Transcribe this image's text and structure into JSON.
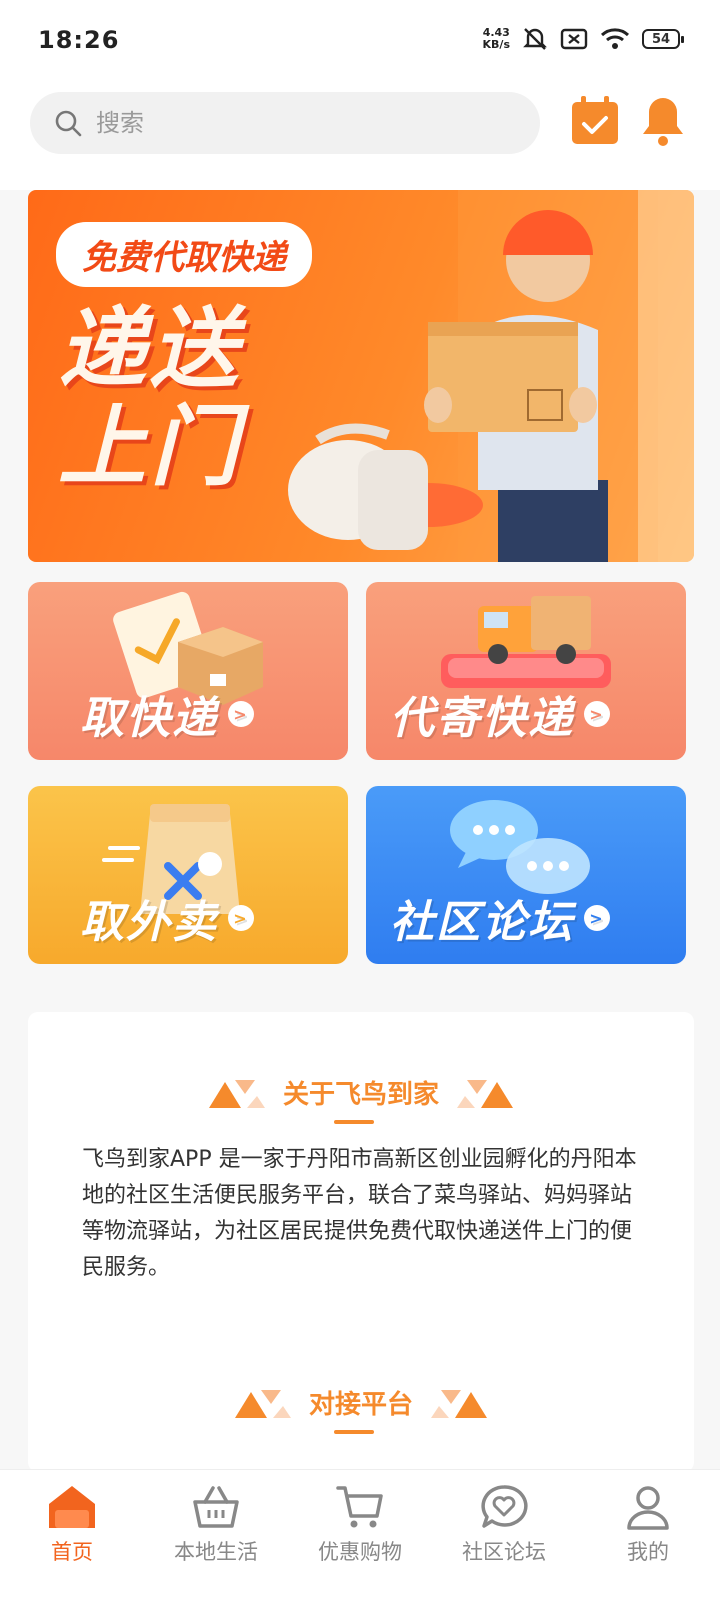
{
  "status_bar": {
    "time": "18:26",
    "net_speed_value": "4.43",
    "net_speed_unit": "KB/s",
    "battery": "54"
  },
  "search": {
    "placeholder": "搜索"
  },
  "banner": {
    "pill_text": "免费代取快递",
    "headline": "递送上门"
  },
  "services": [
    {
      "label": "取快递",
      "color": "#f8906a"
    },
    {
      "label": "代寄快递",
      "color": "#f8906a"
    },
    {
      "label": "取外卖",
      "color": "#f9b43c"
    },
    {
      "label": "社区论坛",
      "color": "#3a8cf5"
    }
  ],
  "about": {
    "title": "关于飞鸟到家",
    "text": "飞鸟到家APP 是一家于丹阳市高新区创业园孵化的丹阳本地的社区生活便民服务平台，联合了菜鸟驿站、妈妈驿站等物流驿站，为社区居民提供免费代取快递送件上门的便民服务。",
    "next_title": "对接平台"
  },
  "tabbar": {
    "items": [
      {
        "label": "首页",
        "icon": "home-icon",
        "active": true
      },
      {
        "label": "本地生活",
        "icon": "basket-icon",
        "active": false
      },
      {
        "label": "优惠购物",
        "icon": "cart-icon",
        "active": false
      },
      {
        "label": "社区论坛",
        "icon": "forum-icon",
        "active": false
      },
      {
        "label": "我的",
        "icon": "user-icon",
        "active": false
      }
    ]
  },
  "colors": {
    "accent": "#f58a2c",
    "active_tab": "#f2641e"
  }
}
